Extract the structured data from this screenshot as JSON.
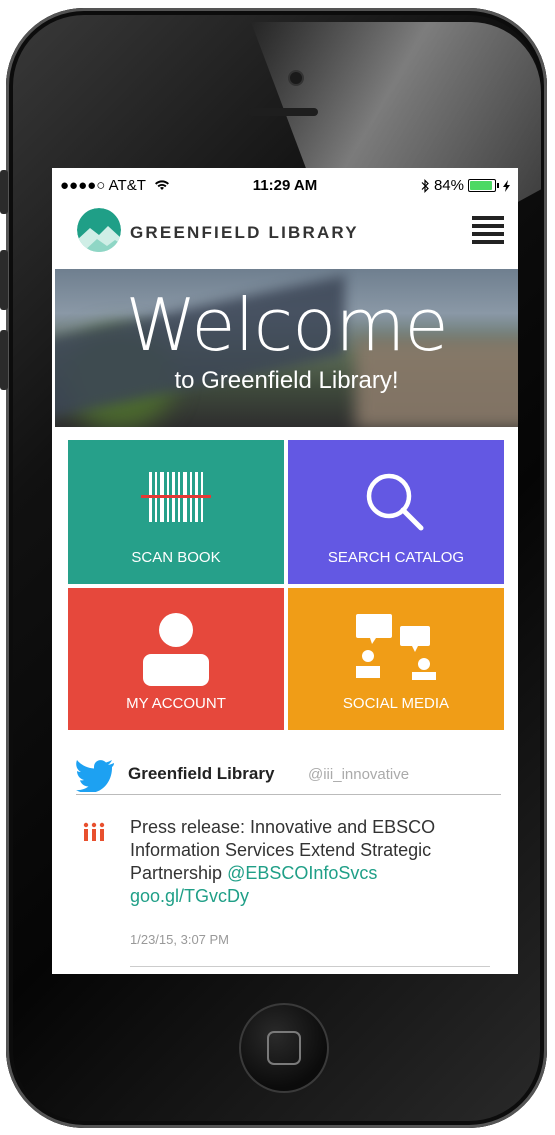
{
  "status_bar": {
    "carrier": "●●●●○ AT&T",
    "wifi_icon": "wifi-icon",
    "time": "11:29 AM",
    "bluetooth_icon": "bluetooth-icon",
    "battery_percent": "84%",
    "battery_level": 0.84
  },
  "header": {
    "title": "GREENFIELD LIBRARY",
    "menu_icon": "hamburger-menu-icon"
  },
  "hero": {
    "title": "Welcome",
    "subtitle": "to Greenfield Library!"
  },
  "tiles": [
    {
      "label": "SCAN BOOK",
      "icon": "barcode-scan-icon",
      "color": "#26a08a"
    },
    {
      "label": "SEARCH CATALOG",
      "icon": "magnifier-icon",
      "color": "#6358e3"
    },
    {
      "label": "MY ACCOUNT",
      "icon": "user-icon",
      "color": "#e6483c"
    },
    {
      "label": "SOCIAL MEDIA",
      "icon": "chat-people-icon",
      "color": "#f09d17"
    }
  ],
  "tweet": {
    "name": "Greenfield Library",
    "handle": "@iii_innovative",
    "text": "Press release: Innovative and EBSCO Information Services Extend Strategic Partnership ",
    "mention": "@EBSCOInfoSvcs",
    "link": "goo.gl/TGvcDy",
    "timestamp": "1/23/15, 3:07 PM"
  },
  "colors": {
    "accent": "#1f9f87",
    "twitter": "#1da1f2",
    "iii": "#e8502e"
  }
}
